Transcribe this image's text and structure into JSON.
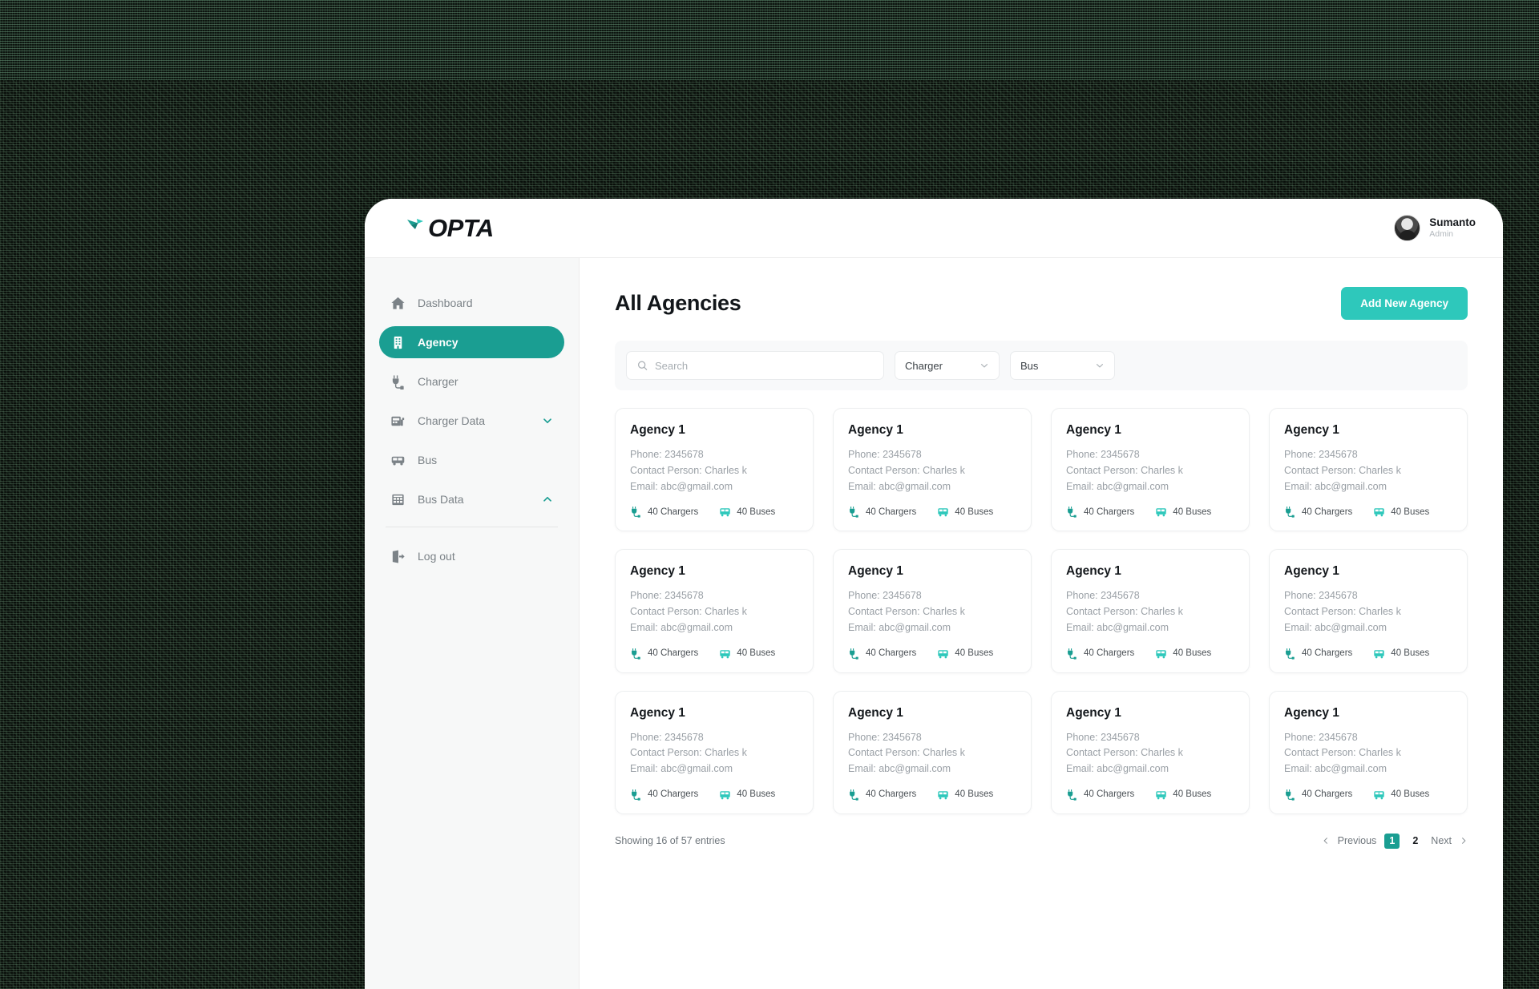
{
  "colors": {
    "accent_dark": "#1a9e92",
    "accent_light": "#2ec8bb",
    "sidebar_bg": "#f7f8f8",
    "muted_text": "#9aa0a6"
  },
  "topbar": {
    "logo_text": "OPTA",
    "profile": {
      "name": "Sumanto",
      "role": "Admin"
    }
  },
  "sidebar": {
    "items": [
      {
        "label": "Dashboard",
        "icon": "home-icon",
        "active": false,
        "chevron": "none"
      },
      {
        "label": "Agency",
        "icon": "building-icon",
        "active": true,
        "chevron": "none"
      },
      {
        "label": "Charger",
        "icon": "plug-icon",
        "active": false,
        "chevron": "none"
      },
      {
        "label": "Charger Data",
        "icon": "charger-data-icon",
        "active": false,
        "chevron": "down"
      },
      {
        "label": "Bus",
        "icon": "bus-icon",
        "active": false,
        "chevron": "none"
      },
      {
        "label": "Bus Data",
        "icon": "bus-data-icon",
        "active": false,
        "chevron": "up"
      },
      {
        "label": "Log out",
        "icon": "logout-icon",
        "active": false,
        "chevron": "none"
      }
    ]
  },
  "main": {
    "title": "All Agencies",
    "add_button_label": "Add New Agency",
    "filters": {
      "search_placeholder": "Search",
      "search_value": "",
      "charger_select": "Charger",
      "bus_select": "Bus"
    },
    "cards": [
      {
        "name": "Agency 1",
        "phone": "Phone: 2345678",
        "contact": "Contact Person: Charles k",
        "email": "Email: abc@gmail.com",
        "chargers": "40 Chargers",
        "buses": "40 Buses"
      },
      {
        "name": "Agency 1",
        "phone": "Phone: 2345678",
        "contact": "Contact Person: Charles k",
        "email": "Email: abc@gmail.com",
        "chargers": "40 Chargers",
        "buses": "40 Buses"
      },
      {
        "name": "Agency 1",
        "phone": "Phone: 2345678",
        "contact": "Contact Person: Charles k",
        "email": "Email: abc@gmail.com",
        "chargers": "40 Chargers",
        "buses": "40 Buses"
      },
      {
        "name": "Agency 1",
        "phone": "Phone: 2345678",
        "contact": "Contact Person: Charles k",
        "email": "Email: abc@gmail.com",
        "chargers": "40 Chargers",
        "buses": "40 Buses"
      },
      {
        "name": "Agency 1",
        "phone": "Phone: 2345678",
        "contact": "Contact Person: Charles k",
        "email": "Email: abc@gmail.com",
        "chargers": "40 Chargers",
        "buses": "40 Buses"
      },
      {
        "name": "Agency 1",
        "phone": "Phone: 2345678",
        "contact": "Contact Person: Charles k",
        "email": "Email: abc@gmail.com",
        "chargers": "40 Chargers",
        "buses": "40 Buses"
      },
      {
        "name": "Agency 1",
        "phone": "Phone: 2345678",
        "contact": "Contact Person: Charles k",
        "email": "Email: abc@gmail.com",
        "chargers": "40 Chargers",
        "buses": "40 Buses"
      },
      {
        "name": "Agency 1",
        "phone": "Phone: 2345678",
        "contact": "Contact Person: Charles k",
        "email": "Email: abc@gmail.com",
        "chargers": "40 Chargers",
        "buses": "40 Buses"
      },
      {
        "name": "Agency 1",
        "phone": "Phone: 2345678",
        "contact": "Contact Person: Charles k",
        "email": "Email: abc@gmail.com",
        "chargers": "40 Chargers",
        "buses": "40 Buses"
      },
      {
        "name": "Agency 1",
        "phone": "Phone: 2345678",
        "contact": "Contact Person: Charles k",
        "email": "Email: abc@gmail.com",
        "chargers": "40 Chargers",
        "buses": "40 Buses"
      },
      {
        "name": "Agency 1",
        "phone": "Phone: 2345678",
        "contact": "Contact Person: Charles k",
        "email": "Email: abc@gmail.com",
        "chargers": "40 Chargers",
        "buses": "40 Buses"
      },
      {
        "name": "Agency 1",
        "phone": "Phone: 2345678",
        "contact": "Contact Person: Charles k",
        "email": "Email: abc@gmail.com",
        "chargers": "40 Chargers",
        "buses": "40 Buses"
      }
    ],
    "pagination": {
      "entries_text": "Showing 16 of 57 entries",
      "previous_label": "Previous",
      "next_label": "Next",
      "pages": [
        "1",
        "2"
      ],
      "active_page": "1"
    }
  }
}
